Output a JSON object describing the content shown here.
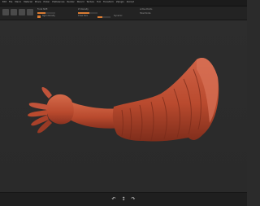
{
  "menu": [
    "Edit",
    "File",
    "Macro",
    "Material",
    "Movie",
    "Picker",
    "Preferences",
    "Render",
    "Stencil",
    "Texture",
    "Tool",
    "Transform",
    "Zplugin",
    "Zscript"
  ],
  "toolbar": {
    "icons": [
      "home-icon",
      "light-box-icon",
      "preview-icon",
      "edit-icon"
    ],
    "group_labels": [
      "Focal Shift",
      "Rgb Intensity",
      "Z Intensity",
      "Draw Size",
      "Dynamic",
      "Active Points",
      "Total Points"
    ],
    "accent": "#d97b32"
  },
  "canvas": {
    "model_color": "#b94a2e",
    "model_shade": "#7f2d1b",
    "model_highlight": "#d46a4a"
  },
  "bottombar": {
    "buttons": [
      "↶",
      "↕",
      "↷"
    ]
  }
}
